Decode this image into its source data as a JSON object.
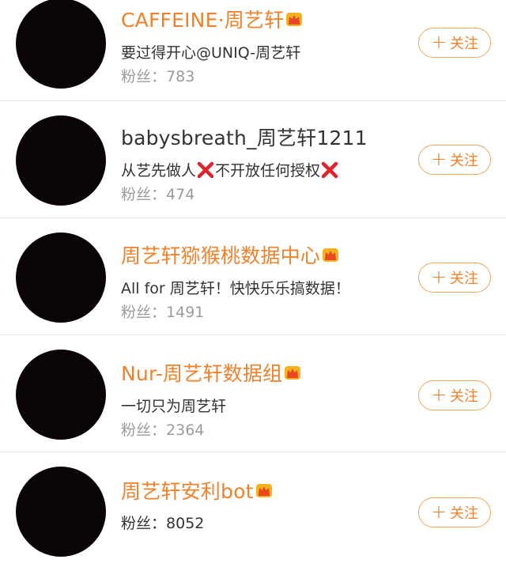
{
  "users": [
    {
      "name": "CAFFEINE·周艺轩",
      "vip": true,
      "bio": "要过得开心@UNIQ-周艺轩",
      "fans_label": "粉丝：",
      "fans_count": "783",
      "follow_label": "关注",
      "plus": "+"
    },
    {
      "name": "babysbreath_周艺轩1211",
      "vip": false,
      "bio_parts": [
        "从艺先做人",
        "不开放任何授权"
      ],
      "fans_label": "粉丝：",
      "fans_count": "474",
      "follow_label": "关注",
      "plus": "+"
    },
    {
      "name": "周艺轩猕猴桃数据中心",
      "vip": true,
      "bio": "All for 周艺轩！快快乐乐搞数据！",
      "fans_label": "粉丝：",
      "fans_count": "1491",
      "follow_label": "关注",
      "plus": "+"
    },
    {
      "name": "Nur-周艺轩数据组",
      "vip": true,
      "bio": "一切只为周艺轩",
      "fans_label": "粉丝：",
      "fans_count": "2364",
      "follow_label": "关注",
      "plus": "+"
    },
    {
      "name": "周艺轩安利bot",
      "vip": true,
      "fans_label": "粉丝：",
      "fans_count": "8052",
      "follow_label": "关注",
      "plus": "+"
    }
  ],
  "colors": {
    "vip_name": "#f2812b",
    "follow_border": "#f2a65e",
    "fans_text": "#9b9b9b",
    "avatar": "#0a0407"
  }
}
